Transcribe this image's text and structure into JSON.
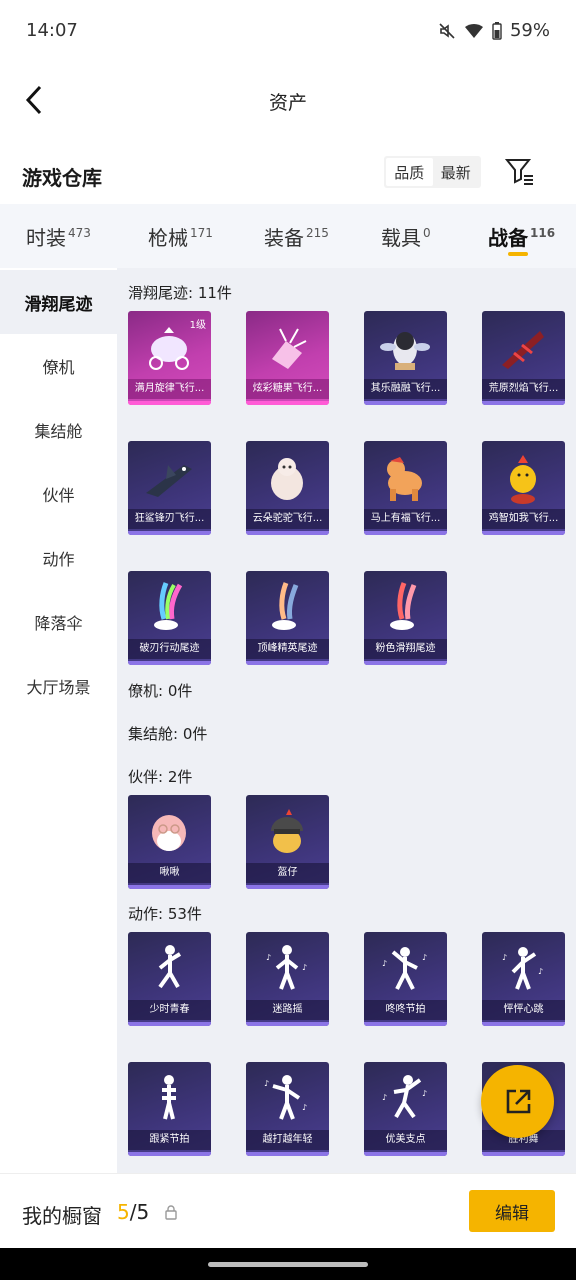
{
  "status": {
    "time": "14:07",
    "battery": "59%"
  },
  "nav": {
    "title": "资产"
  },
  "warehouse": {
    "title": "游戏仓库",
    "sort_options": [
      "品质",
      "最新"
    ],
    "active_sort": "品质"
  },
  "tabs": [
    {
      "label": "时装",
      "count": "473"
    },
    {
      "label": "枪械",
      "count": "171"
    },
    {
      "label": "装备",
      "count": "215"
    },
    {
      "label": "载具",
      "count": "0"
    },
    {
      "label": "战备",
      "count": "116",
      "active": true
    }
  ],
  "sidebar": [
    {
      "label": "滑翔尾迹",
      "active": true
    },
    {
      "label": "僚机"
    },
    {
      "label": "集结舱"
    },
    {
      "label": "伙伴"
    },
    {
      "label": "动作"
    },
    {
      "label": "降落伞"
    },
    {
      "label": "大厅场景"
    }
  ],
  "sections": {
    "trail": {
      "label": "滑翔尾迹: 11件",
      "items": [
        {
          "name": "满月旋律飞行...",
          "level": "1级"
        },
        {
          "name": "炫彩糖果飞行..."
        },
        {
          "name": "其乐融融飞行..."
        },
        {
          "name": "荒原烈焰飞行..."
        },
        {
          "name": "狂鲨锋刃飞行..."
        },
        {
          "name": "云朵驼驼飞行..."
        },
        {
          "name": "马上有福飞行..."
        },
        {
          "name": "鸡智如我飞行..."
        },
        {
          "name": "破刃行动尾迹"
        },
        {
          "name": "顶峰精英尾迹"
        },
        {
          "name": "粉色滑翔尾迹"
        }
      ]
    },
    "wingman": {
      "label": "僚机: 0件"
    },
    "capsule": {
      "label": "集结舱: 0件"
    },
    "partner": {
      "label": "伙伴: 2件",
      "items": [
        {
          "name": "啾啾"
        },
        {
          "name": "盔仔"
        }
      ]
    },
    "emote": {
      "label": "动作: 53件",
      "items": [
        {
          "name": "少时青春"
        },
        {
          "name": "迷路摇"
        },
        {
          "name": "咚咚节拍"
        },
        {
          "name": "怦怦心跳"
        },
        {
          "name": "跟紧节拍"
        },
        {
          "name": "越打越年轻"
        },
        {
          "name": "优美支点"
        },
        {
          "name": "胜利舞"
        }
      ]
    }
  },
  "bottom": {
    "window_label": "我的橱窗",
    "window_current": "5",
    "window_total": "/5",
    "edit_label": "编辑"
  },
  "colors": {
    "accent": "#f5b400",
    "card_purple": "#3d3478",
    "card_pink": "#c13fae"
  },
  "icons": [
    "back-arrow-icon",
    "filter-icon",
    "lock-icon",
    "share-icon",
    "wifi-icon",
    "battery-icon",
    "mute-icon"
  ]
}
